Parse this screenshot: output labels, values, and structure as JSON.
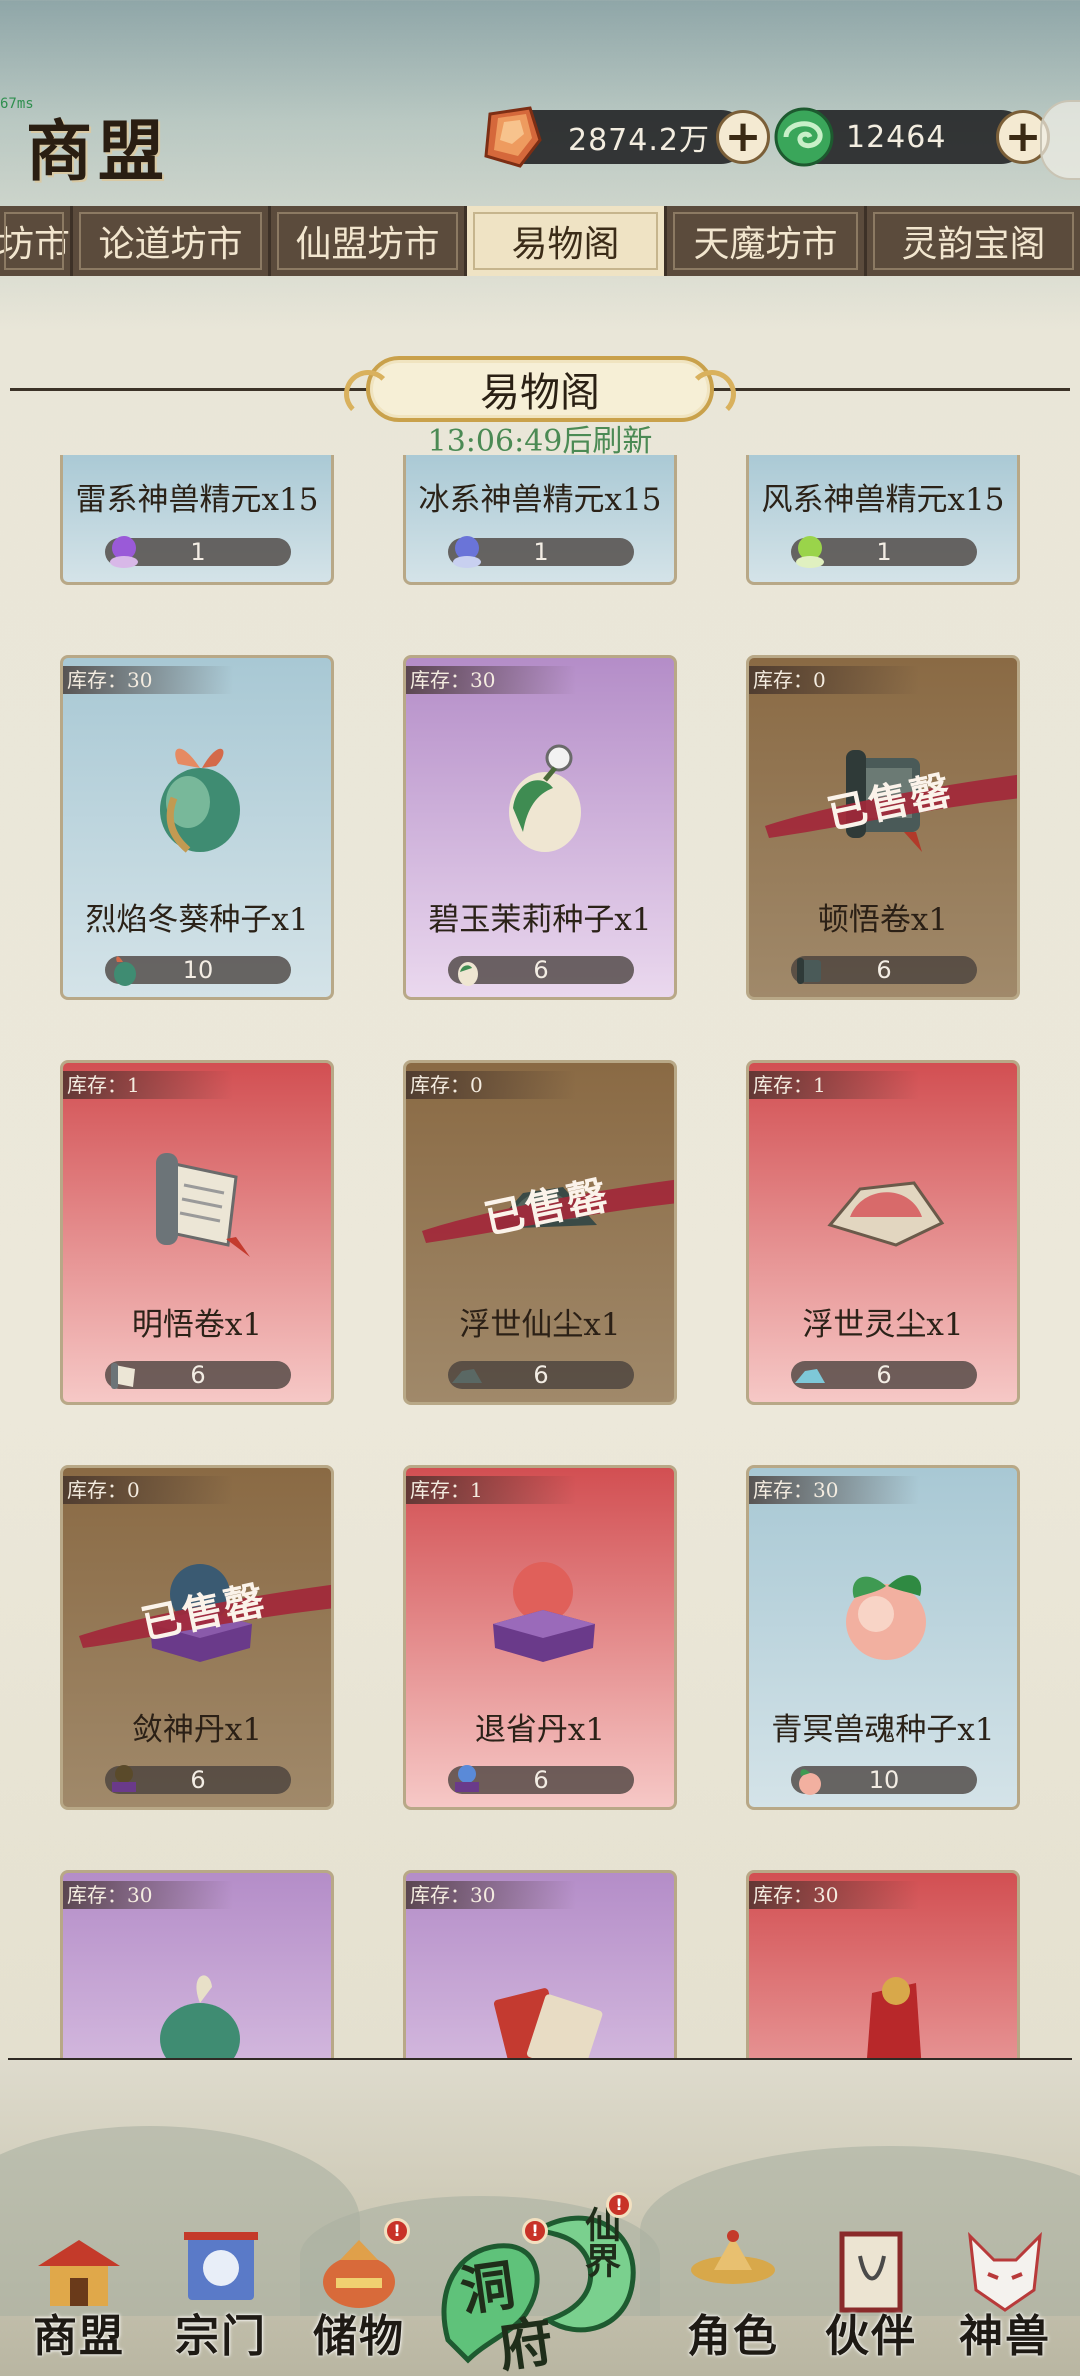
{
  "debug": {
    "ping": "67ms"
  },
  "header": {
    "title": "商盟",
    "currencies": [
      {
        "icon": "spirit-stone-icon",
        "value": "2874.2万"
      },
      {
        "icon": "jade-swirl-icon",
        "value": "12464"
      }
    ]
  },
  "tabs": [
    {
      "label": "坊市",
      "active": false
    },
    {
      "label": "论道坊市",
      "active": false
    },
    {
      "label": "仙盟坊市",
      "active": false
    },
    {
      "label": "易物阁",
      "active": true
    },
    {
      "label": "天魔坊市",
      "active": false
    },
    {
      "label": "灵韵宝阁",
      "active": false
    }
  ],
  "section": {
    "title": "易物阁",
    "refresh": "13:06:49后刷新"
  },
  "sold_out_label": "已售罄",
  "items": [
    {
      "name": "雷系神兽精元x15",
      "price": "1",
      "theme": "blue",
      "short": true,
      "price_icon": "purple-orb-icon"
    },
    {
      "name": "冰系神兽精元x15",
      "price": "1",
      "theme": "blue",
      "short": true,
      "price_icon": "blue-orb-icon"
    },
    {
      "name": "风系神兽精元x15",
      "price": "1",
      "theme": "blue",
      "short": true,
      "price_icon": "green-orb-icon"
    },
    {
      "stock": "库存：30",
      "name": "烈焰冬葵种子x1",
      "price": "10",
      "theme": "blue",
      "art": "seed-icon",
      "sold_out": false
    },
    {
      "stock": "库存：30",
      "name": "碧玉茉莉种子x1",
      "price": "6",
      "theme": "purple",
      "art": "seed-icon",
      "sold_out": false
    },
    {
      "stock": "库存：0",
      "name": "顿悟卷x1",
      "price": "6",
      "theme": "brown",
      "art": "scroll-icon",
      "sold_out": true
    },
    {
      "stock": "库存：1",
      "name": "明悟卷x1",
      "price": "6",
      "theme": "red",
      "art": "scroll-icon",
      "sold_out": false
    },
    {
      "stock": "库存：0",
      "name": "浮世仙尘x1",
      "price": "6",
      "theme": "brown",
      "art": "dust-pile-icon",
      "sold_out": true
    },
    {
      "stock": "库存：1",
      "name": "浮世灵尘x1",
      "price": "6",
      "theme": "red",
      "art": "dust-pile-icon",
      "sold_out": false
    },
    {
      "stock": "库存：0",
      "name": "敛神丹x1",
      "price": "6",
      "theme": "brown",
      "art": "pill-icon",
      "sold_out": true
    },
    {
      "stock": "库存：1",
      "name": "退省丹x1",
      "price": "6",
      "theme": "red",
      "art": "pill-icon",
      "sold_out": false
    },
    {
      "stock": "库存：30",
      "name": "青冥兽魂种子x1",
      "price": "10",
      "theme": "blue",
      "art": "peach-seed-icon",
      "sold_out": false
    },
    {
      "stock": "库存：30",
      "theme": "purple",
      "art": "seed-icon"
    },
    {
      "stock": "库存：30",
      "theme": "purple",
      "art": "book-icon"
    },
    {
      "stock": "库存：30",
      "theme": "red",
      "art": "banner-icon"
    }
  ],
  "bottom_nav": [
    {
      "label": "商盟",
      "icon": "pavilion-icon",
      "badge": false
    },
    {
      "label": "宗门",
      "icon": "sect-banner-icon",
      "badge": false
    },
    {
      "label": "储物",
      "icon": "storage-bag-icon",
      "badge": true
    },
    {
      "label": "角色",
      "icon": "character-hat-icon",
      "badge": false
    },
    {
      "label": "伙伴",
      "icon": "partner-scroll-icon",
      "badge": false
    },
    {
      "label": "神兽",
      "icon": "fox-mask-icon",
      "badge": false
    }
  ],
  "center_nav": {
    "label_top": "洞",
    "label_bottom": "府",
    "label_side": "仙界",
    "badge": "!"
  },
  "colors": {
    "accent_green": "#4b8a54",
    "badge_red": "#c83228",
    "tab_bg": "#5b4b3c"
  }
}
